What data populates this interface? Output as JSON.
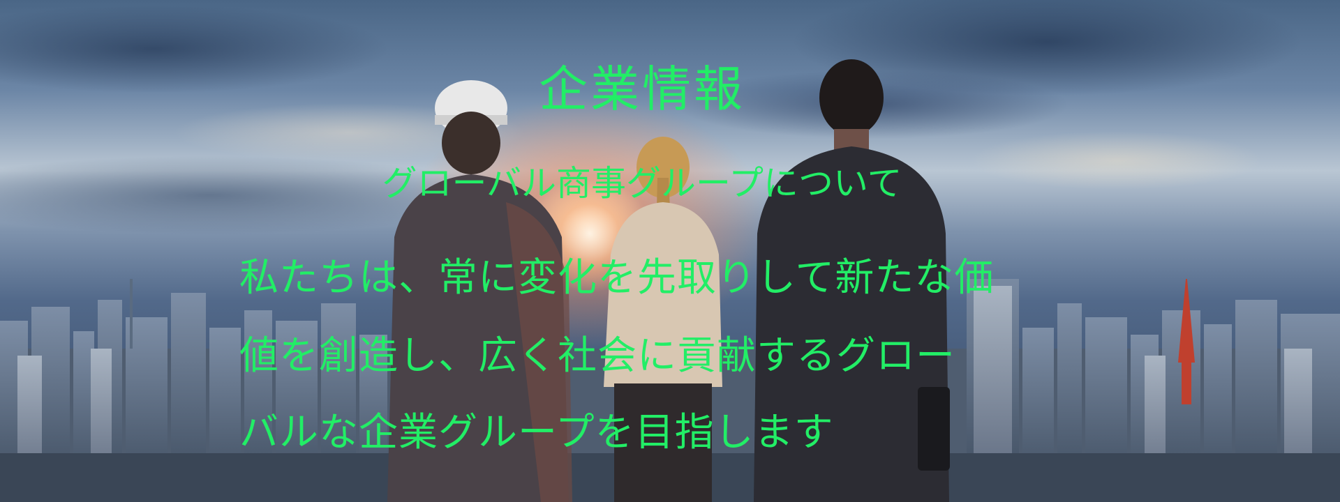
{
  "hero": {
    "title": "企業情報",
    "subtitle": "グローバル商事グループについて",
    "body_lines": [
      "私たちは、常に変化を先取りして新たな価",
      "値を創造し、広く社会に貢献するグロー",
      "バルな企業グループを目指します"
    ],
    "text_color": "#22ee66",
    "background_image": "business-people-overlooking-city-skyline-at-sunrise"
  }
}
